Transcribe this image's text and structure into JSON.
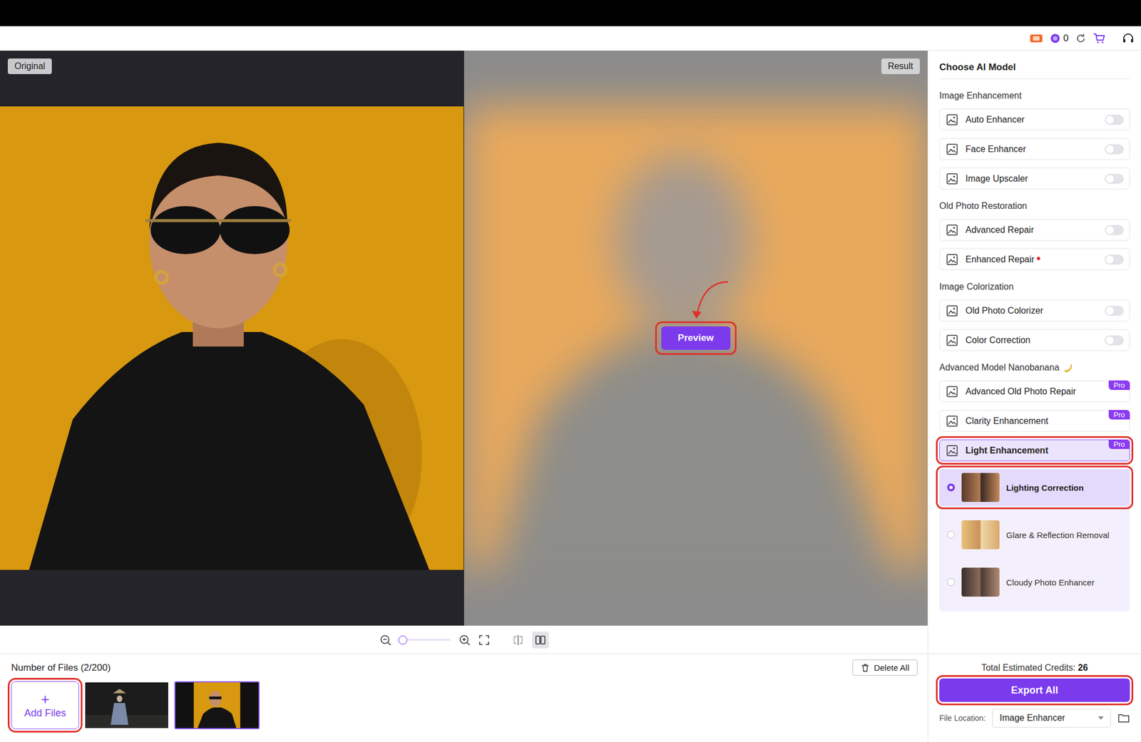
{
  "header": {
    "credits": "0"
  },
  "canvas": {
    "original_label": "Original",
    "result_label": "Result",
    "preview": {
      "label": "Preview",
      "highlighted": true
    }
  },
  "toolbar": {
    "zoom_level": 0,
    "view_modes": [
      {
        "kind": "split",
        "selected": false
      },
      {
        "kind": "side-by-side",
        "selected": true
      }
    ]
  },
  "files": {
    "count_label": "Number of Files (2/200)",
    "add": {
      "icon": "+",
      "label": "Add Files",
      "highlighted": true
    },
    "delete_label": "Delete All",
    "thumbnails": [
      {
        "kind": "dark",
        "selected": false
      },
      {
        "kind": "orange",
        "selected": true
      }
    ]
  },
  "panel": {
    "title": "Choose AI Model",
    "sections": [
      {
        "title": "Image Enhancement",
        "items": [
          {
            "label": "Auto Enhancer",
            "kind": "toggle",
            "on": false,
            "new": false
          },
          {
            "label": "Face Enhancer",
            "kind": "toggle",
            "on": false,
            "new": false
          },
          {
            "label": "Image Upscaler",
            "kind": "toggle",
            "on": false,
            "new": false
          }
        ]
      },
      {
        "title": "Old Photo Restoration",
        "items": [
          {
            "label": "Advanced Repair",
            "kind": "toggle",
            "on": false,
            "new": false
          },
          {
            "label": "Enhanced Repair",
            "kind": "toggle",
            "on": false,
            "new": true
          }
        ]
      },
      {
        "title": "Image Colorization",
        "items": [
          {
            "label": "Old Photo Colorizer",
            "kind": "toggle",
            "on": false,
            "new": false
          },
          {
            "label": "Color Correction",
            "kind": "toggle",
            "on": false,
            "new": false
          }
        ]
      },
      {
        "title": "Advanced Model Nanobanana",
        "items": [
          {
            "label": "Advanced Old Photo Repair",
            "kind": "pro",
            "badge": "Pro",
            "selected": false,
            "expanded": false,
            "highlighted": false,
            "options": []
          },
          {
            "label": "Clarity Enhancement",
            "kind": "pro",
            "badge": "Pro",
            "selected": false,
            "expanded": false,
            "highlighted": false,
            "options": []
          },
          {
            "label": "Light Enhancement",
            "kind": "pro",
            "badge": "Pro",
            "selected": true,
            "expanded": true,
            "highlighted": true,
            "options": [
              {
                "label": "Lighting Correction",
                "selected": true,
                "highlighted": true
              },
              {
                "label": "Glare & Reflection Removal",
                "selected": false,
                "highlighted": false
              },
              {
                "label": "Cloudy Photo Enhancer",
                "selected": false,
                "highlighted": false
              }
            ]
          }
        ]
      }
    ]
  },
  "footer": {
    "credits_label": "Total Estimated Credits:",
    "credits_value": "26",
    "export": {
      "label": "Export All",
      "highlighted": true
    },
    "location_label": "File Location:",
    "location_value": "Image Enhancer"
  }
}
